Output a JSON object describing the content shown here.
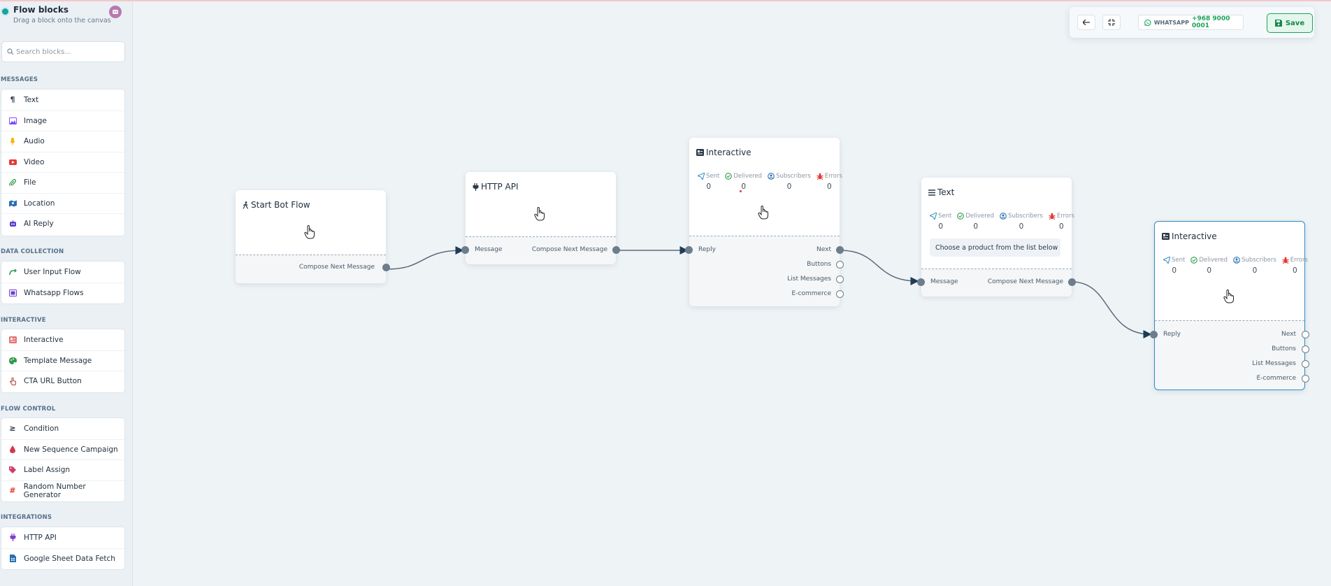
{
  "sidebar": {
    "title": "Flow blocks",
    "subtitle": "Drag a block onto the canvas",
    "search_placeholder": "Search blocks...",
    "sections": [
      {
        "label": "MESSAGES",
        "items": [
          {
            "label": "Text",
            "icon": "paragraph-icon",
            "color": "#2b3a4a"
          },
          {
            "label": "Image",
            "icon": "image-icon",
            "color": "#7c4dff"
          },
          {
            "label": "Audio",
            "icon": "microphone-icon",
            "color": "#f5b400"
          },
          {
            "label": "Video",
            "icon": "video-icon",
            "color": "#e53935"
          },
          {
            "label": "File",
            "icon": "paperclip-icon",
            "color": "#2e9a4a"
          },
          {
            "label": "Location",
            "icon": "map-icon",
            "color": "#2a6fb5"
          },
          {
            "label": "AI Reply",
            "icon": "robot-icon",
            "color": "#5a3fd1"
          }
        ]
      },
      {
        "label": "DATA COLLECTION",
        "items": [
          {
            "label": "User Input Flow",
            "icon": "flow-icon",
            "color": "#2e9a4a"
          },
          {
            "label": "Whatsapp Flows",
            "icon": "flows-icon",
            "color": "#6b3fd1"
          }
        ]
      },
      {
        "label": "INTERACTIVE",
        "items": [
          {
            "label": "Interactive",
            "icon": "interactive-icon",
            "color": "#e57373"
          },
          {
            "label": "Template Message",
            "icon": "palette-icon",
            "color": "#2e9a4a"
          },
          {
            "label": "CTA URL Button",
            "icon": "pointer-icon",
            "color": "#b0463f"
          }
        ]
      },
      {
        "label": "FLOW CONTROL",
        "items": [
          {
            "label": "Condition",
            "icon": "greater-equal-icon",
            "color": "#2b3a4a"
          },
          {
            "label": "New Sequence Campaign",
            "icon": "drop-icon",
            "color": "#d23a4a"
          },
          {
            "label": "Label Assign",
            "icon": "tags-icon",
            "color": "#d23a6a"
          },
          {
            "label": "Random Number Generator",
            "icon": "hash-icon",
            "color": "#e53935"
          }
        ]
      },
      {
        "label": "INTEGRATIONS",
        "items": [
          {
            "label": "HTTP API",
            "icon": "plug-icon",
            "color": "#7c3fd1"
          },
          {
            "label": "Google Sheet Data Fetch",
            "icon": "sheet-icon",
            "color": "#2a6fb5"
          }
        ]
      }
    ]
  },
  "toolbar": {
    "channel_label": "WHATSAPP",
    "phone": "+968 9000 0001",
    "save_label": "Save"
  },
  "nodes": {
    "start": {
      "title": "Start Bot Flow",
      "out_label": "Compose Next Message"
    },
    "http": {
      "title": "HTTP API",
      "in_label": "Message",
      "out_label": "Compose Next Message"
    },
    "interactive1": {
      "title": "Interactive",
      "stats": [
        {
          "label": "Sent",
          "value": "0"
        },
        {
          "label": "Delivered",
          "value": "0"
        },
        {
          "label": "Subscribers",
          "value": "0"
        },
        {
          "label": "Errors",
          "value": "0"
        }
      ],
      "in_label": "Reply",
      "outputs": [
        "Next",
        "Buttons",
        "List Messages",
        "E-commerce"
      ]
    },
    "text": {
      "title": "Text",
      "stats": [
        {
          "label": "Sent",
          "value": "0"
        },
        {
          "label": "Delivered",
          "value": "0"
        },
        {
          "label": "Subscribers",
          "value": "0"
        },
        {
          "label": "Errors",
          "value": "0"
        }
      ],
      "message": "Choose a product from the list below",
      "in_label": "Message",
      "out_label": "Compose Next Message"
    },
    "interactive2": {
      "title": "Interactive",
      "stats": [
        {
          "label": "Sent",
          "value": "0"
        },
        {
          "label": "Delivered",
          "value": "0"
        },
        {
          "label": "Subscribers",
          "value": "0"
        },
        {
          "label": "Errors",
          "value": "0"
        }
      ],
      "in_label": "Reply",
      "outputs": [
        "Next",
        "Buttons",
        "List Messages",
        "E-commerce"
      ]
    }
  }
}
